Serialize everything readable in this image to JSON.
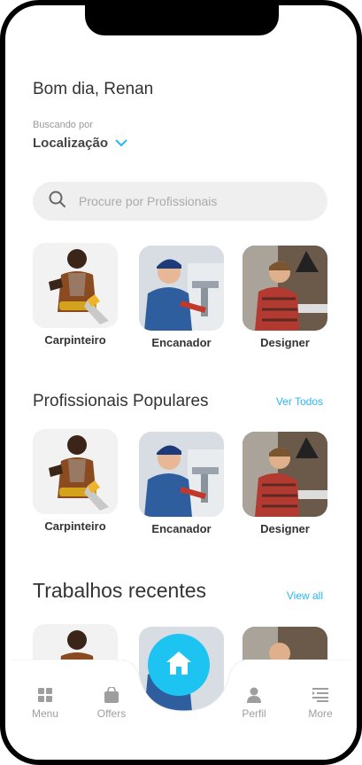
{
  "greeting": "Bom dia, Renan",
  "location": {
    "label": "Buscando por",
    "value": "Localização"
  },
  "search": {
    "placeholder": "Procure por Profissionais"
  },
  "categories": [
    {
      "label": "Carpinteiro"
    },
    {
      "label": "Encanador"
    },
    {
      "label": "Designer"
    }
  ],
  "popular": {
    "title": "Profissionais Populares",
    "link": "Ver Todos",
    "items": [
      {
        "label": "Carpinteiro"
      },
      {
        "label": "Encanador"
      },
      {
        "label": "Designer"
      }
    ]
  },
  "recent": {
    "title": "Trabalhos recentes",
    "link": "View all"
  },
  "nav": {
    "menu": "Menu",
    "offers": "Offers",
    "perfil": "Perfil",
    "more": "More"
  },
  "colors": {
    "accent": "#1ec4f1",
    "link": "#29b6f6"
  }
}
